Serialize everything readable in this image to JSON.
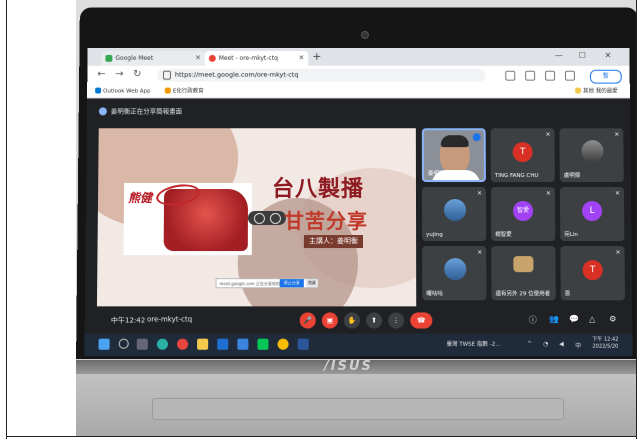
{
  "browser": {
    "tabs": [
      {
        "label": "Google Meet"
      },
      {
        "label": "Meet - ore-mkyt-ctq"
      }
    ],
    "url": "https://meet.google.com/ore-mkyt-ctq",
    "profile_label": "暫",
    "bookmarks": [
      "Outlook Web App",
      "E化行政教育"
    ],
    "bookmarks_right": "其他 我的最愛"
  },
  "meet": {
    "presenting_text": "姜明衡正在分享簡報畫面",
    "slide": {
      "title": "台八製播",
      "subtitle": "甘苦分享",
      "host": "主講人：姜明衡",
      "poster_script": "熊健",
      "share_bar_text": "meet.google.com 正在分享你的畫面",
      "stop_button": "停止分享",
      "hide_button": "隱藏"
    },
    "participants": [
      {
        "name": "姜明衡",
        "type": "self"
      },
      {
        "name": "TING FANG CHU",
        "initial": "T",
        "color": "#d93025"
      },
      {
        "name": "盧明傑",
        "type": "photo"
      },
      {
        "name": "yujing",
        "type": "photo"
      },
      {
        "name": "楊智愛",
        "initial": "智愛",
        "color": "#a142f4"
      },
      {
        "name": "宛Lin",
        "initial": "L",
        "color": "#a142f4"
      },
      {
        "name": "曙咕咕",
        "type": "photo"
      },
      {
        "name": "還有另外 29 位使用者",
        "type": "group"
      },
      {
        "name": "恩",
        "initial": "T",
        "color": "#d93025"
      }
    ],
    "controls": {
      "time": "中午12:42",
      "meeting_code": "ore-mkyt-ctq"
    }
  },
  "taskbar": {
    "network_text": "臺灣 TWSE 指數 -2…",
    "clock_time": "下午 12:42",
    "clock_date": "2022/5/20"
  },
  "laptop": {
    "brand": "/ISUS"
  }
}
